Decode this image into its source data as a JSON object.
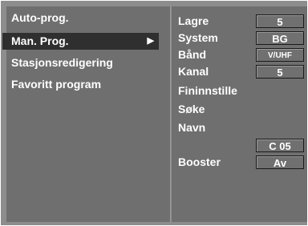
{
  "menu": {
    "items": [
      {
        "label": "Auto-prog."
      },
      {
        "label": "Man. Prog.",
        "arrow": "▶"
      },
      {
        "label": "Stasjonsredigering"
      },
      {
        "label": "Favoritt program"
      }
    ]
  },
  "settings": {
    "lagre": {
      "label": "Lagre",
      "value": "5"
    },
    "system": {
      "label": "System",
      "value": "BG"
    },
    "band": {
      "label": "Bånd",
      "value": "V/UHF"
    },
    "kanal": {
      "label": "Kanal",
      "value": "5"
    },
    "fininnstille": {
      "label": "Fininnstille"
    },
    "soke": {
      "label": "Søke"
    },
    "navn": {
      "label": "Navn",
      "value": "C 05"
    },
    "booster": {
      "label": "Booster",
      "value": "Av"
    }
  },
  "colors": {
    "background": "#8d8d8d",
    "panel": "#6f6f6f",
    "selected": "#2f2f2f"
  }
}
